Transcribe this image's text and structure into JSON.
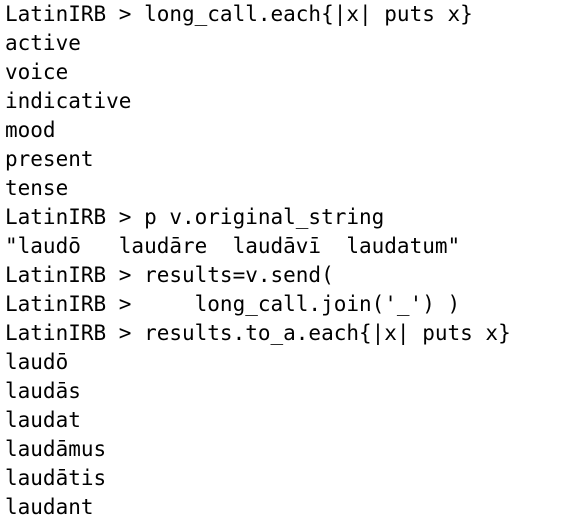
{
  "terminal": {
    "lines": [
      "LatinIRB > long_call.each{|x| puts x}",
      "active",
      "voice",
      "indicative",
      "mood",
      "present",
      "tense",
      "LatinIRB > p v.original_string",
      "\"laudō   laudāre  laudāvī  laudatum\"",
      "LatinIRB > results=v.send(",
      "LatinIRB >     long_call.join('_') )",
      "LatinIRB > results.to_a.each{|x| puts x}",
      "laudō",
      "laudās",
      "laudat",
      "laudāmus",
      "laudātis",
      "laudant"
    ]
  },
  "colors": {
    "background": "#ffffff",
    "text": "#000000"
  }
}
